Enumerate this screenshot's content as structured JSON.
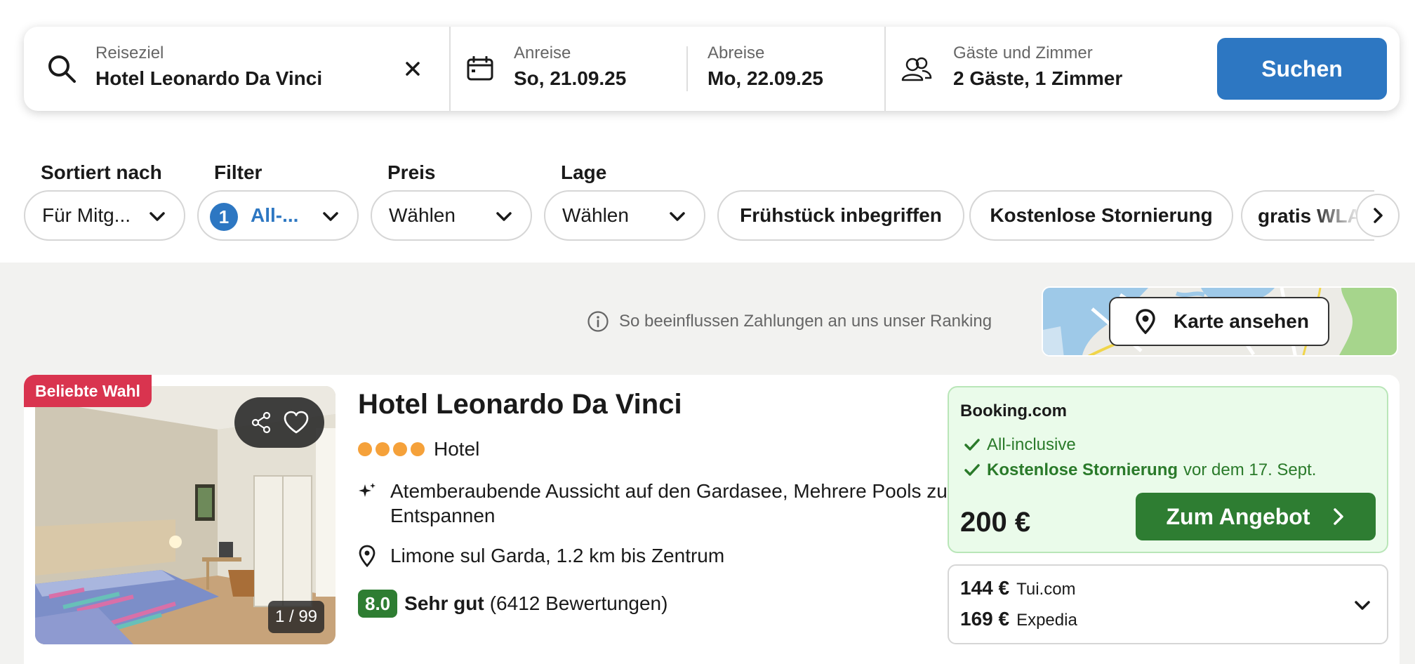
{
  "search": {
    "destination_label": "Reiseziel",
    "destination_value": "Hotel Leonardo Da Vinci",
    "arrival_label": "Anreise",
    "arrival_value": "So, 21.09.25",
    "departure_label": "Abreise",
    "departure_value": "Mo, 22.09.25",
    "guests_label": "Gäste und Zimmer",
    "guests_value": "2 Gäste, 1 Zimmer",
    "submit_label": "Suchen"
  },
  "filters": {
    "sort_label": "Sortiert nach",
    "sort_value": "Für Mitg...",
    "filter_label": "Filter",
    "filter_count": "1",
    "filter_value": "All-...",
    "price_label": "Preis",
    "price_value": "Wählen",
    "location_label": "Lage",
    "location_value": "Wählen",
    "quick": [
      "Frühstück inbegriffen",
      "Kostenlose Stornierung",
      "gratis WLAN"
    ]
  },
  "ranking_info": "So beeinflussen Zahlungen an uns unser Ranking",
  "map_button": "Karte ansehen",
  "hotel": {
    "badge": "Beliebte Wahl",
    "photo_counter": "1 / 99",
    "name": "Hotel Leonardo Da Vinci",
    "star_count": 4,
    "type": "Hotel",
    "highlight": "Atemberaubende Aussicht auf den Gardasee, Mehrere Pools zum Entspannen",
    "location": "Limone sul Garda, 1.2 km bis Zentrum",
    "rating_score": "8.0",
    "rating_word": "Sehr gut",
    "rating_count": "(6412 Bewertungen)",
    "offer": {
      "provider": "Booking.com",
      "feature_1": "All-inclusive",
      "feature_2": "Kostenlose Stornierung",
      "feature_2_suffix": "vor dem 17. Sept.",
      "price": "200 €",
      "cta": "Zum Angebot"
    },
    "alternatives": [
      {
        "price": "144 €",
        "provider": "Tui.com"
      },
      {
        "price": "169 €",
        "provider": "Expedia"
      }
    ]
  },
  "colors": {
    "primary_blue": "#2d77c2",
    "deal_green": "#2e7d32",
    "badge_red": "#d9344f",
    "star_orange": "#f5a13a",
    "offer_bg": "#eafbea"
  }
}
